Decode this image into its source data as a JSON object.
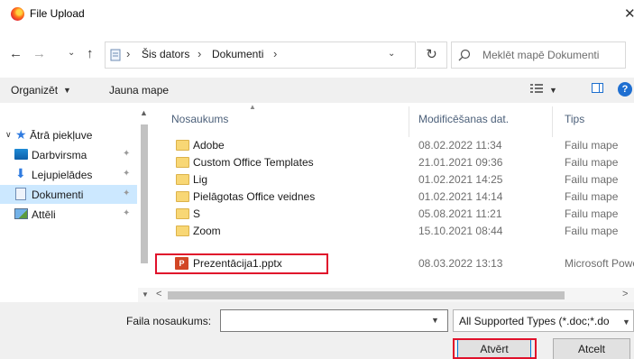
{
  "window": {
    "title": "File Upload",
    "close_glyph": "✕"
  },
  "nav": {
    "back": "←",
    "forward": "→",
    "recent": "⌄",
    "up": "↑",
    "address": {
      "crumbs": [
        "Šis dators",
        "Dokumenti"
      ],
      "sep": "›",
      "dropdown": "⌄"
    },
    "refresh": "↻",
    "search_placeholder": "Meklēt mapē Dokumenti"
  },
  "toolbar": {
    "organize": "Organizēt",
    "organize_caret": "▼",
    "new_folder": "Jauna mape",
    "view_caret": "▼",
    "help": "?"
  },
  "sidebar": {
    "quick_access": "Ātrā piekļuve",
    "items": [
      {
        "label": "Darbvirsma",
        "icon": "desktop-icon"
      },
      {
        "label": "Lejupielādes",
        "icon": "downloads-icon"
      },
      {
        "label": "Dokumenti",
        "icon": "documents-icon",
        "selected": true
      },
      {
        "label": "Attēli",
        "icon": "pictures-icon"
      }
    ],
    "pin_glyph": "📌"
  },
  "filelist": {
    "columns": {
      "name": "Nosaukums",
      "modified": "Modificēšanas dat.",
      "type": "Tips"
    },
    "rows": [
      {
        "name": "Adobe",
        "date": "08.02.2022 11:34",
        "type": "Failu mape",
        "kind": "folder"
      },
      {
        "name": "Custom Office Templates",
        "date": "21.01.2021 09:36",
        "type": "Failu mape",
        "kind": "folder"
      },
      {
        "name": "Lig",
        "date": "01.02.2021 14:25",
        "type": "Failu mape",
        "kind": "folder"
      },
      {
        "name": "Pielāgotas Office veidnes",
        "date": "01.02.2021 14:14",
        "type": "Failu mape",
        "kind": "folder"
      },
      {
        "name": "S",
        "date": "05.08.2021 11:21",
        "type": "Failu mape",
        "kind": "folder"
      },
      {
        "name": "Zoom",
        "date": "15.10.2021 08:44",
        "type": "Failu mape",
        "kind": "folder"
      },
      {
        "name": "Prezentācija1.pptx",
        "date": "08.03.2022 13:13",
        "type": "Microsoft Powe",
        "kind": "pptx"
      }
    ]
  },
  "footer": {
    "filename_label": "Faila nosaukums:",
    "filename_value": "",
    "filetype": "All Supported Types (*.doc;*.do",
    "open": "Atvērt",
    "cancel": "Atcelt"
  },
  "colors": {
    "accent": "#0078d7",
    "highlight": "#e0112b",
    "selected_bg": "#cce8ff"
  }
}
